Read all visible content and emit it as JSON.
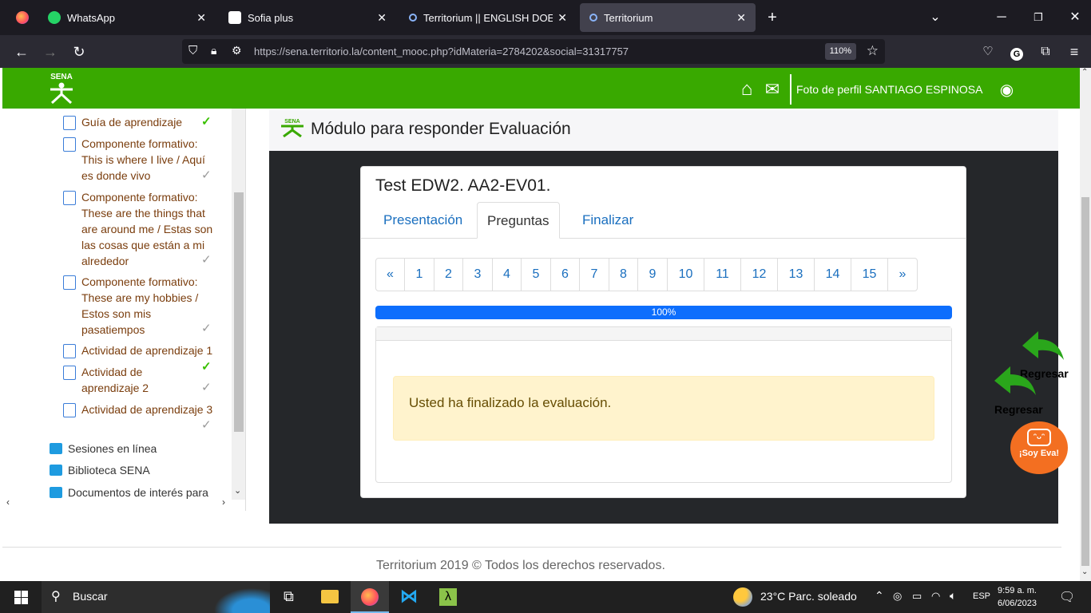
{
  "browser": {
    "tabs": [
      {
        "label": "",
        "icon": "firefox-icon"
      },
      {
        "label": "WhatsApp",
        "icon": "whatsapp-icon"
      },
      {
        "label": "Sofia plus",
        "icon": "sofia-icon"
      },
      {
        "label": "Territorium || ENGLISH DOES W…",
        "icon": "territorium-icon"
      },
      {
        "label": "Territorium",
        "icon": "territorium-icon",
        "active": true
      }
    ],
    "url": "https://sena.territorio.la/content_mooc.php?idMateria=2784202&social=31317757",
    "zoom": "110%"
  },
  "header": {
    "logo_text": "SENA",
    "profile_text": "Foto de perfil SANTIAGO ESPINOSA"
  },
  "sidebar": {
    "items": [
      {
        "label": "Guía de aprendizaje",
        "check": "green"
      },
      {
        "label": "Componente formativo: This is where I live / Aquí es donde vivo",
        "check": "gray"
      },
      {
        "label": "Componente formativo: These are the things that are around me / Estas son las cosas que están a mi alrededor",
        "check": "gray"
      },
      {
        "label": "Componente formativo: These are my hobbies / Estos son mis pasatiempos",
        "check": "gray"
      },
      {
        "label": "Actividad de aprendizaje 1",
        "check": ""
      },
      {
        "label": "Actividad de aprendizaje 2",
        "check": "both"
      },
      {
        "label": "Actividad de aprendizaje 3",
        "check": "gray"
      }
    ],
    "folders": [
      {
        "label": "Sesiones en línea"
      },
      {
        "label": "Biblioteca SENA"
      },
      {
        "label": "Documentos de interés para"
      }
    ]
  },
  "module": {
    "title": "Módulo para responder Evaluación"
  },
  "test": {
    "title": "Test EDW2. AA2-EV01.",
    "tabs": [
      "Presentación",
      "Preguntas",
      "Finalizar"
    ],
    "active_tab": "Preguntas",
    "pages": [
      "«",
      "1",
      "2",
      "3",
      "4",
      "5",
      "6",
      "7",
      "8",
      "9",
      "10",
      "11",
      "12",
      "13",
      "14",
      "15",
      "»"
    ],
    "progress_text": "100%",
    "progress_value": 1.0,
    "alert": "Usted ha finalizado la evaluación."
  },
  "floating": {
    "regresar_1": "Regresar",
    "regresar_2": "Regresar",
    "eva": "¡Soy Eva!"
  },
  "footer": "Territorium 2019 © Todos los derechos reservados.",
  "taskbar": {
    "search_label": "Buscar",
    "weather": "23°C  Parc. soleado",
    "lang": "ESP",
    "time": "9:59 a. m.",
    "date": "6/06/2023"
  },
  "colors": {
    "header_green": "#39a900",
    "link_blue": "#1a6fbf",
    "progress_blue": "#0d6efd",
    "alert_bg": "#fff3cd"
  }
}
